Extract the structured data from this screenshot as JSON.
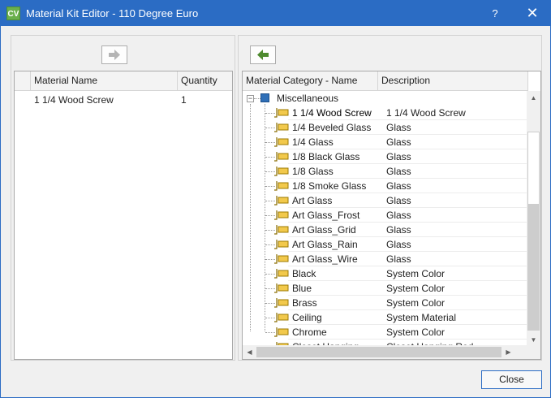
{
  "window": {
    "title": "Material Kit Editor - 110 Degree Euro",
    "app_badge": "CV",
    "help_label": "?",
    "close_glyph": "✕"
  },
  "kit_grid": {
    "columns": [
      "Material Name",
      "Quantity"
    ],
    "rows": [
      {
        "name": "1 1/4 Wood Screw",
        "quantity": "1"
      }
    ]
  },
  "material_tree": {
    "columns": [
      "Material Category - Name",
      "Description"
    ],
    "category": "Miscellaneous",
    "rows": [
      {
        "name": "1 1/4 Wood Screw",
        "description": "1 1/4 Wood Screw",
        "selected": true
      },
      {
        "name": "1/4 Beveled Glass",
        "description": "Glass"
      },
      {
        "name": "1/4 Glass",
        "description": "Glass"
      },
      {
        "name": "1/8 Black Glass",
        "description": "Glass"
      },
      {
        "name": "1/8 Glass",
        "description": "Glass"
      },
      {
        "name": "1/8 Smoke Glass",
        "description": "Glass"
      },
      {
        "name": "Art Glass",
        "description": "Glass"
      },
      {
        "name": "Art Glass_Frost",
        "description": "Glass"
      },
      {
        "name": "Art Glass_Grid",
        "description": "Glass"
      },
      {
        "name": "Art Glass_Rain",
        "description": "Glass"
      },
      {
        "name": "Art Glass_Wire",
        "description": "Glass"
      },
      {
        "name": "Black",
        "description": "System Color"
      },
      {
        "name": "Blue",
        "description": "System Color"
      },
      {
        "name": "Brass",
        "description": "System Color"
      },
      {
        "name": "Ceiling",
        "description": "System Material"
      },
      {
        "name": "Chrome",
        "description": "System Color"
      },
      {
        "name": "Closet Hanging",
        "description": "Closet Hanging Rod"
      }
    ]
  },
  "buttons": {
    "close_label": "Close"
  },
  "icons": {
    "add_arrow": "right-arrow-icon",
    "remove_arrow": "left-arrow-icon",
    "folder": "folder-icon",
    "material": "material-icon"
  },
  "colors": {
    "titlebar": "#2b6cc4",
    "arrow_active": "#4e8a2e",
    "arrow_disabled": "#b5b5b5"
  }
}
